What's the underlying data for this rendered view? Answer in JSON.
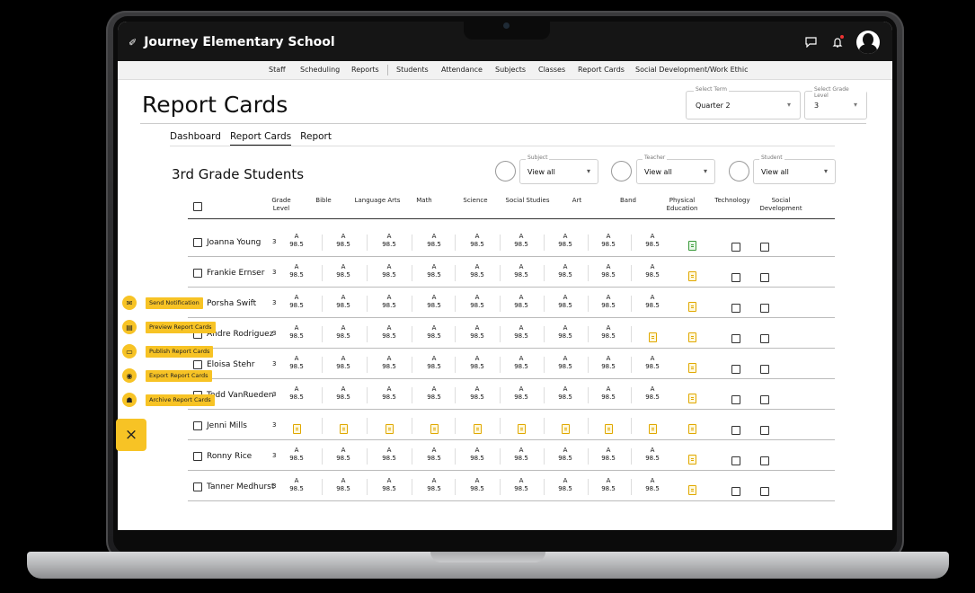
{
  "app": {
    "brand": "Journey Elementary School"
  },
  "nav": {
    "items": [
      "Staff",
      "Scheduling",
      "Reports",
      "Students",
      "Attendance",
      "Subjects",
      "Classes",
      "Report Cards",
      "Social Development/Work Ethic"
    ]
  },
  "page": {
    "title": "Report Cards"
  },
  "term_select": {
    "label": "Select Term",
    "value": "Quarter 2"
  },
  "grade_select": {
    "label": "Select Grade Level",
    "value": "3"
  },
  "tabs": [
    "Dashboard",
    "Report Cards",
    "Report"
  ],
  "section": {
    "title": "3rd Grade Students"
  },
  "filters": {
    "subject": {
      "label": "Subject",
      "value": "View all"
    },
    "teacher": {
      "label": "Teacher",
      "value": "View all"
    },
    "student": {
      "label": "Student",
      "value": "View all"
    }
  },
  "table": {
    "headers": {
      "grade_level": "Grade Level",
      "bible": "Bible",
      "language_arts": "Language Arts",
      "math": "Math",
      "science": "Science",
      "social_studies": "Social Studies",
      "art": "Art",
      "band": "Band",
      "physical_education": "Physical Education",
      "technology": "Technology",
      "social_development": "Social Development"
    },
    "grade_letter": "A",
    "grade_score": "98.5",
    "rows": [
      {
        "name": "Joanna Young",
        "level": "3"
      },
      {
        "name": "Frankie Ernser",
        "level": "3"
      },
      {
        "name": "Porsha Swift",
        "level": "3"
      },
      {
        "name": "Andre Rodriguez",
        "level": "3"
      },
      {
        "name": "Eloisa Stehr",
        "level": "3"
      },
      {
        "name": "Todd VanRueden",
        "level": "3"
      },
      {
        "name": "Jenni Mills",
        "level": "3"
      },
      {
        "name": "Ronny Rice",
        "level": "3"
      },
      {
        "name": "Tanner Medhurst",
        "level": "3"
      }
    ]
  },
  "fab_menu": {
    "items": [
      "Send Notification",
      "Preview Report Cards",
      "Publish Report Cards",
      "Export Report Cards",
      "Archive Report Cards"
    ],
    "close": "×"
  },
  "colors": {
    "accent": "#f7c325",
    "topbar": "#151515"
  }
}
